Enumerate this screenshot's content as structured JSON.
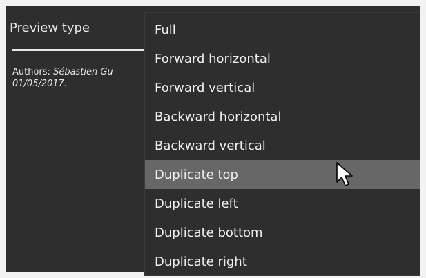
{
  "property": {
    "label": "Preview type"
  },
  "authors": {
    "label": "Authors:",
    "names": "Sébastien Gu",
    "date": "01/05/2017."
  },
  "dropdown": {
    "items": [
      {
        "label": "Full"
      },
      {
        "label": "Forward horizontal"
      },
      {
        "label": "Forward vertical"
      },
      {
        "label": "Backward horizontal"
      },
      {
        "label": "Backward vertical"
      },
      {
        "label": "Duplicate top",
        "hovered": true
      },
      {
        "label": "Duplicate left"
      },
      {
        "label": "Duplicate bottom"
      },
      {
        "label": "Duplicate right"
      }
    ]
  },
  "cursor": {
    "icon": "arrow-cursor-icon"
  },
  "colors": {
    "panel_bg": "#2e2e2e",
    "hover_bg": "#676767",
    "text": "#efefef"
  }
}
